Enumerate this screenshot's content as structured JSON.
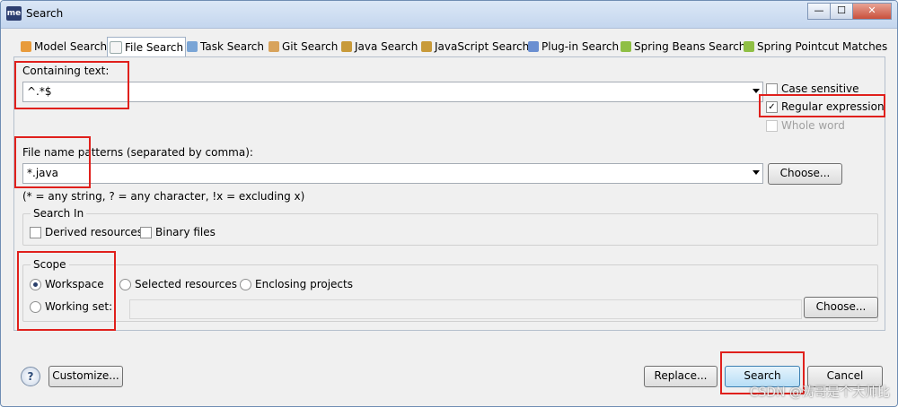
{
  "window": {
    "title": "Search",
    "app_icon_text": "me",
    "controls": {
      "minimize": "—",
      "maximize": "☐",
      "close": "✕"
    }
  },
  "tabs": [
    {
      "label": "Model Search",
      "icon": "model-icon",
      "active": false
    },
    {
      "label": "File Search",
      "icon": "file-icon",
      "active": true
    },
    {
      "label": "Task Search",
      "icon": "task-icon",
      "active": false
    },
    {
      "label": "Git Search",
      "icon": "git-icon",
      "active": false
    },
    {
      "label": "Java Search",
      "icon": "java-icon",
      "active": false
    },
    {
      "label": "JavaScript Search",
      "icon": "javascript-icon",
      "active": false
    },
    {
      "label": "Plug-in Search",
      "icon": "plugin-icon",
      "active": false
    },
    {
      "label": "Spring Beans Search",
      "icon": "spring-icon",
      "active": false
    },
    {
      "label": "Spring Pointcut Matches",
      "icon": "spring-icon",
      "active": false
    }
  ],
  "containing_text": {
    "label": "Containing text:",
    "value": "^.*$"
  },
  "options": {
    "case_sensitive": {
      "label": "Case sensitive",
      "checked": false,
      "enabled": true
    },
    "regular_expression": {
      "label": "Regular expression",
      "checked": true,
      "enabled": true
    },
    "whole_word": {
      "label": "Whole word",
      "checked": false,
      "enabled": false
    }
  },
  "file_patterns": {
    "label": "File name patterns (separated by comma):",
    "value": "*.java",
    "hint": "(* = any string, ? = any character, !x = excluding x)",
    "choose_label": "Choose..."
  },
  "search_in": {
    "title": "Search In",
    "derived": {
      "label": "Derived resources",
      "checked": false
    },
    "binary": {
      "label": "Binary files",
      "checked": false
    }
  },
  "scope": {
    "title": "Scope",
    "workspace": "Workspace",
    "selected_resources": "Selected resources",
    "enclosing_projects": "Enclosing projects",
    "working_set": "Working set:",
    "selected": "workspace",
    "choose_label": "Choose..."
  },
  "footer": {
    "help": "?",
    "customize": "Customize...",
    "replace": "Replace...",
    "search": "Search",
    "cancel": "Cancel"
  },
  "watermark": "CSDN @涛哥是个大帅比",
  "colors": {
    "highlight": "#e0201c",
    "accent": "#3c7fb1"
  }
}
